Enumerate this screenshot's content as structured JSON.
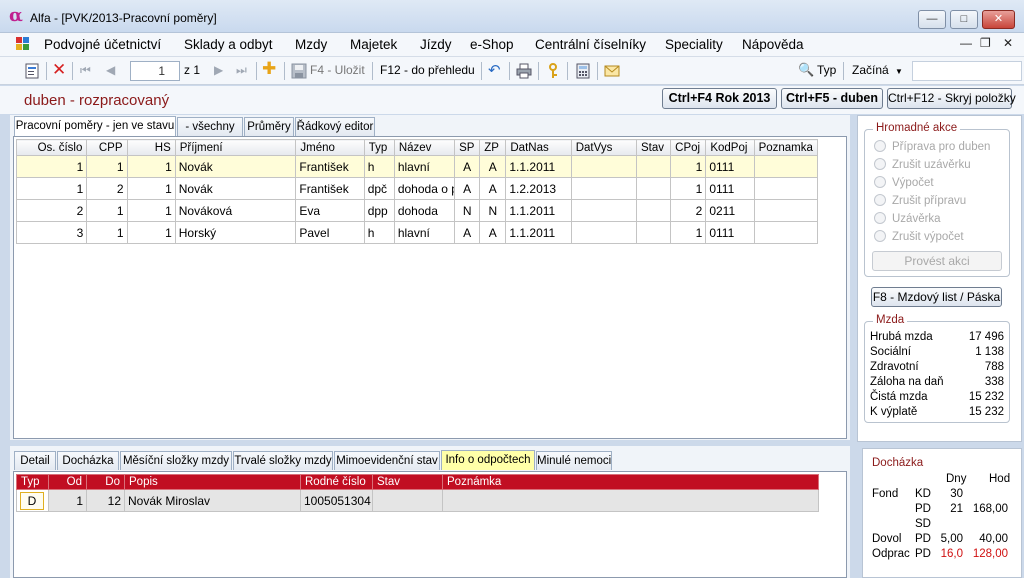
{
  "window": {
    "title": "Alfa - [PVK/2013-Pracovní poměry]",
    "logo": "α"
  },
  "menu": [
    "Podvojné účetnictví",
    "Sklady a odbyt",
    "Mzdy",
    "Majetek",
    "Jízdy",
    "e-Shop",
    "Centrální číselníky",
    "Speciality",
    "Nápověda"
  ],
  "toolbar": {
    "record": "1",
    "record_total": "z 1",
    "save": "F4 - Uložit",
    "overview": "F12 - do přehledu",
    "typ_label": "Typ",
    "filter_value": "Začíná"
  },
  "status": "duben - rozpracovaný",
  "buttons": {
    "year": "Ctrl+F4 Rok 2013",
    "month": "Ctrl+F5 - duben",
    "hide": "Ctrl+F12 - Skryj položky"
  },
  "top_tabs": [
    "Pracovní poměry - jen ve stavu",
    "- všechny",
    "Průměry",
    "Řádkový editor"
  ],
  "grid_columns": [
    "Os. číslo",
    "CPP",
    "HS",
    "Příjmení",
    "Jméno",
    "Typ",
    "Název",
    "SP",
    "ZP",
    "DatNas",
    "DatVys",
    "Stav",
    "CPoj",
    "KodPoj",
    "Poznamka"
  ],
  "grid_rows": [
    [
      "1",
      "1",
      "1",
      "Novák",
      "František",
      "h",
      "hlavní",
      "A",
      "A",
      "1.1.2011",
      "",
      "",
      "1",
      "0111",
      ""
    ],
    [
      "1",
      "2",
      "1",
      "Novák",
      "František",
      "dpč",
      "dohoda o pr",
      "A",
      "A",
      "1.2.2013",
      "",
      "",
      "1",
      "0111",
      ""
    ],
    [
      "2",
      "1",
      "1",
      "Nováková",
      "Eva",
      "dpp",
      "dohoda",
      "N",
      "N",
      "1.1.2011",
      "",
      "",
      "2",
      "0211",
      ""
    ],
    [
      "3",
      "1",
      "1",
      "Horský",
      "Pavel",
      "h",
      "hlavní",
      "A",
      "A",
      "1.1.2011",
      "",
      "",
      "1",
      "0111",
      ""
    ]
  ],
  "bottom_tabs": [
    "Detail",
    "Docházka",
    "Měsíční složky mzdy",
    "Trvalé složky mzdy",
    "Mimoevidenční stav",
    "Info o odpočtech",
    "Minulé nemoci"
  ],
  "sub_columns": [
    "Typ",
    "Od",
    "Do",
    "Popis",
    "Rodné číslo",
    "Stav",
    "Poznámka"
  ],
  "sub_rows": [
    [
      "D",
      "1",
      "12",
      "Novák Miroslav",
      "1005051304",
      "",
      ""
    ]
  ],
  "hromadne": {
    "title": "Hromadné akce",
    "options": [
      "Příprava pro duben",
      "Zrušit uzávěrku",
      "Výpočet",
      "Zrušit přípravu",
      "Uzávěrka",
      "Zrušit výpočet"
    ],
    "action": "Provést akci"
  },
  "f8": "F8 - Mzdový list / Páska",
  "mzda": {
    "title": "Mzda",
    "rows": [
      {
        "label": "Hrubá mzda",
        "value": "17 496"
      },
      {
        "label": "Sociální",
        "value": "1 138"
      },
      {
        "label": "Zdravotní",
        "value": "788"
      },
      {
        "label": "Záloha na daň",
        "value": "338"
      },
      {
        "label": "Čistá mzda",
        "value": "15 232"
      },
      {
        "label": "K výplatě",
        "value": "15 232"
      }
    ]
  },
  "dochazka": {
    "title": "Docházka",
    "col_dny": "Dny",
    "col_hod": "Hod",
    "rows": [
      {
        "group": "Fond",
        "code": "KD",
        "dny": "30",
        "hod": ""
      },
      {
        "group": "",
        "code": "PD",
        "dny": "21",
        "hod": "168,00"
      },
      {
        "group": "",
        "code": "SD",
        "dny": "",
        "hod": ""
      },
      {
        "group": "Dovol",
        "code": "PD",
        "dny": "5,00",
        "hod": "40,00"
      },
      {
        "group": "Odprac",
        "code": "PD",
        "dny": "16,0",
        "hod": "128,00"
      }
    ],
    "highlight_color": "#d01010"
  }
}
